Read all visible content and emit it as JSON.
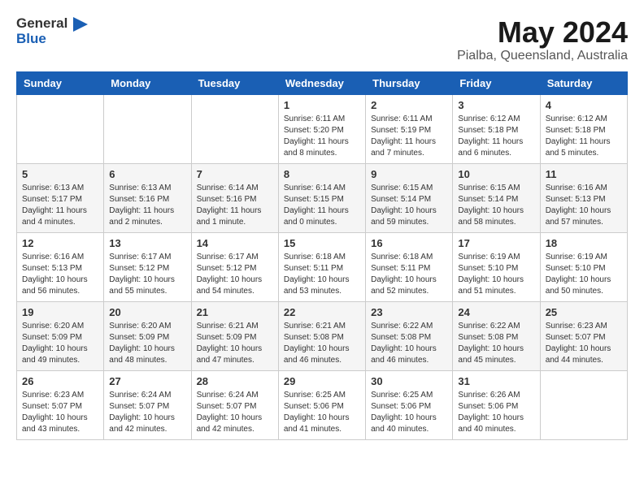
{
  "header": {
    "logo_general": "General",
    "logo_blue": "Blue",
    "title": "May 2024",
    "subtitle": "Pialba, Queensland, Australia"
  },
  "calendar": {
    "weekdays": [
      "Sunday",
      "Monday",
      "Tuesday",
      "Wednesday",
      "Thursday",
      "Friday",
      "Saturday"
    ],
    "weeks": [
      [
        {
          "day": "",
          "info": ""
        },
        {
          "day": "",
          "info": ""
        },
        {
          "day": "",
          "info": ""
        },
        {
          "day": "1",
          "info": "Sunrise: 6:11 AM\nSunset: 5:20 PM\nDaylight: 11 hours\nand 8 minutes."
        },
        {
          "day": "2",
          "info": "Sunrise: 6:11 AM\nSunset: 5:19 PM\nDaylight: 11 hours\nand 7 minutes."
        },
        {
          "day": "3",
          "info": "Sunrise: 6:12 AM\nSunset: 5:18 PM\nDaylight: 11 hours\nand 6 minutes."
        },
        {
          "day": "4",
          "info": "Sunrise: 6:12 AM\nSunset: 5:18 PM\nDaylight: 11 hours\nand 5 minutes."
        }
      ],
      [
        {
          "day": "5",
          "info": "Sunrise: 6:13 AM\nSunset: 5:17 PM\nDaylight: 11 hours\nand 4 minutes."
        },
        {
          "day": "6",
          "info": "Sunrise: 6:13 AM\nSunset: 5:16 PM\nDaylight: 11 hours\nand 2 minutes."
        },
        {
          "day": "7",
          "info": "Sunrise: 6:14 AM\nSunset: 5:16 PM\nDaylight: 11 hours\nand 1 minute."
        },
        {
          "day": "8",
          "info": "Sunrise: 6:14 AM\nSunset: 5:15 PM\nDaylight: 11 hours\nand 0 minutes."
        },
        {
          "day": "9",
          "info": "Sunrise: 6:15 AM\nSunset: 5:14 PM\nDaylight: 10 hours\nand 59 minutes."
        },
        {
          "day": "10",
          "info": "Sunrise: 6:15 AM\nSunset: 5:14 PM\nDaylight: 10 hours\nand 58 minutes."
        },
        {
          "day": "11",
          "info": "Sunrise: 6:16 AM\nSunset: 5:13 PM\nDaylight: 10 hours\nand 57 minutes."
        }
      ],
      [
        {
          "day": "12",
          "info": "Sunrise: 6:16 AM\nSunset: 5:13 PM\nDaylight: 10 hours\nand 56 minutes."
        },
        {
          "day": "13",
          "info": "Sunrise: 6:17 AM\nSunset: 5:12 PM\nDaylight: 10 hours\nand 55 minutes."
        },
        {
          "day": "14",
          "info": "Sunrise: 6:17 AM\nSunset: 5:12 PM\nDaylight: 10 hours\nand 54 minutes."
        },
        {
          "day": "15",
          "info": "Sunrise: 6:18 AM\nSunset: 5:11 PM\nDaylight: 10 hours\nand 53 minutes."
        },
        {
          "day": "16",
          "info": "Sunrise: 6:18 AM\nSunset: 5:11 PM\nDaylight: 10 hours\nand 52 minutes."
        },
        {
          "day": "17",
          "info": "Sunrise: 6:19 AM\nSunset: 5:10 PM\nDaylight: 10 hours\nand 51 minutes."
        },
        {
          "day": "18",
          "info": "Sunrise: 6:19 AM\nSunset: 5:10 PM\nDaylight: 10 hours\nand 50 minutes."
        }
      ],
      [
        {
          "day": "19",
          "info": "Sunrise: 6:20 AM\nSunset: 5:09 PM\nDaylight: 10 hours\nand 49 minutes."
        },
        {
          "day": "20",
          "info": "Sunrise: 6:20 AM\nSunset: 5:09 PM\nDaylight: 10 hours\nand 48 minutes."
        },
        {
          "day": "21",
          "info": "Sunrise: 6:21 AM\nSunset: 5:09 PM\nDaylight: 10 hours\nand 47 minutes."
        },
        {
          "day": "22",
          "info": "Sunrise: 6:21 AM\nSunset: 5:08 PM\nDaylight: 10 hours\nand 46 minutes."
        },
        {
          "day": "23",
          "info": "Sunrise: 6:22 AM\nSunset: 5:08 PM\nDaylight: 10 hours\nand 46 minutes."
        },
        {
          "day": "24",
          "info": "Sunrise: 6:22 AM\nSunset: 5:08 PM\nDaylight: 10 hours\nand 45 minutes."
        },
        {
          "day": "25",
          "info": "Sunrise: 6:23 AM\nSunset: 5:07 PM\nDaylight: 10 hours\nand 44 minutes."
        }
      ],
      [
        {
          "day": "26",
          "info": "Sunrise: 6:23 AM\nSunset: 5:07 PM\nDaylight: 10 hours\nand 43 minutes."
        },
        {
          "day": "27",
          "info": "Sunrise: 6:24 AM\nSunset: 5:07 PM\nDaylight: 10 hours\nand 42 minutes."
        },
        {
          "day": "28",
          "info": "Sunrise: 6:24 AM\nSunset: 5:07 PM\nDaylight: 10 hours\nand 42 minutes."
        },
        {
          "day": "29",
          "info": "Sunrise: 6:25 AM\nSunset: 5:06 PM\nDaylight: 10 hours\nand 41 minutes."
        },
        {
          "day": "30",
          "info": "Sunrise: 6:25 AM\nSunset: 5:06 PM\nDaylight: 10 hours\nand 40 minutes."
        },
        {
          "day": "31",
          "info": "Sunrise: 6:26 AM\nSunset: 5:06 PM\nDaylight: 10 hours\nand 40 minutes."
        },
        {
          "day": "",
          "info": ""
        }
      ]
    ]
  }
}
